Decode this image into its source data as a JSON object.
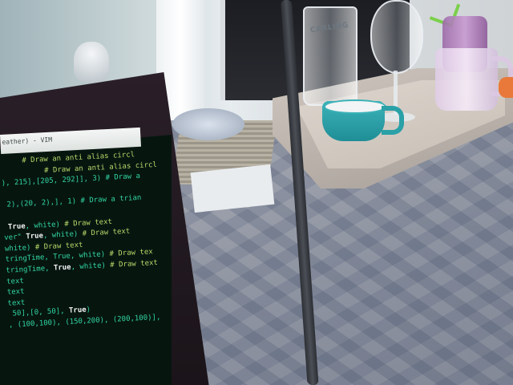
{
  "photo": {
    "subject": "laptop",
    "pint_glass_text": "CARLING"
  },
  "laptop": {
    "window_title": "eather) - VIM",
    "code_lines": [
      {
        "pre": "     ",
        "comment": "# Draw an anti alias circl"
      },
      {
        "pre": "          ",
        "comment": "# Draw an anti alias circl"
      },
      {
        "pre": "), 215],[205, 292]], 3) # Draw a",
        "comment": ""
      },
      {
        "pre": "                  ",
        "comment": ""
      },
      {
        "pre": " 2),(20, 2),], 1) # Draw a trian",
        "comment": ""
      },
      {
        "pre": "                  ",
        "comment": ""
      },
      {
        "pre": " ",
        "kw": "True",
        "mid": ", white) ",
        "comment": "# Draw text"
      },
      {
        "pre": "ver\" ",
        "kw": "True",
        "mid": ", white) ",
        "comment": "# Draw text"
      },
      {
        "pre": "",
        "kw": "",
        "mid": "white) ",
        "comment": "# Draw text"
      },
      {
        "pre": "tringTime, True, white) ",
        "comment": "# Draw tex"
      },
      {
        "pre": "",
        "comment": ""
      },
      {
        "pre": "tringTime, ",
        "kw": "True",
        "mid": ", white) ",
        "comment": "# Draw text"
      },
      {
        "pre": "text",
        "comment": ""
      },
      {
        "pre": "text",
        "comment": ""
      },
      {
        "pre": "text",
        "comment": ""
      },
      {
        "pre": "",
        "comment": ""
      },
      {
        "pre": " 50],[0, 50], ",
        "kw": "True",
        "mid": ")",
        "comment": ""
      },
      {
        "pre": ", (100,100), (150,200), (200,100)],",
        "comment": ""
      }
    ]
  }
}
